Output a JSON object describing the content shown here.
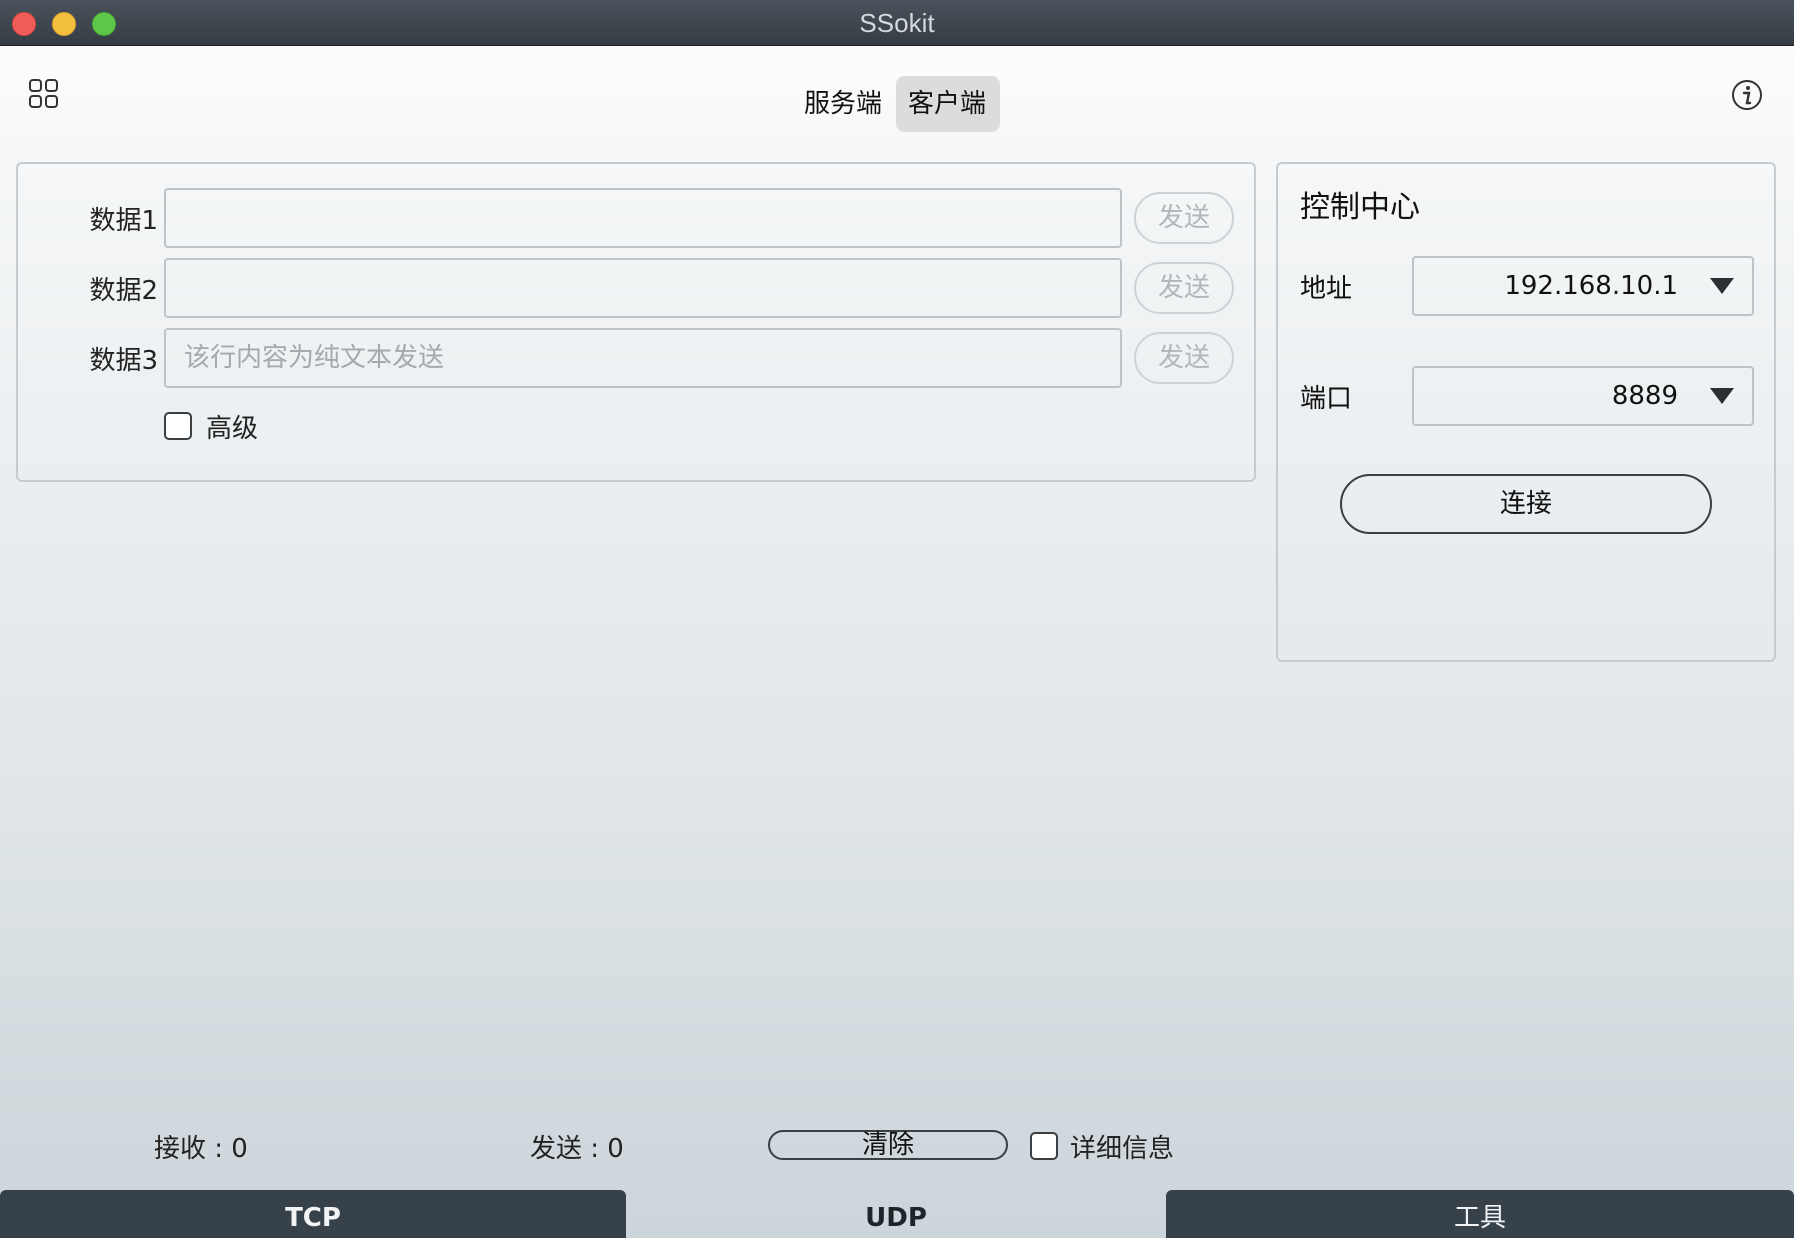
{
  "window": {
    "title": "SSokit"
  },
  "toolbar": {
    "grid_icon": "grid-icon",
    "info_icon": "info-icon",
    "tabs": [
      {
        "label": "服务端",
        "selected": false
      },
      {
        "label": "客户端",
        "selected": true
      }
    ]
  },
  "data_panel": {
    "rows": [
      {
        "label": "数据1",
        "value": "",
        "placeholder": "",
        "send_label": "发送"
      },
      {
        "label": "数据2",
        "value": "",
        "placeholder": "",
        "send_label": "发送"
      },
      {
        "label": "数据3",
        "value": "",
        "placeholder": "该行内容为纯文本发送",
        "send_label": "发送"
      }
    ],
    "advanced": {
      "label": "高级",
      "checked": false
    }
  },
  "control_center": {
    "title": "控制中心",
    "address": {
      "label": "地址",
      "value": "192.168.10.1"
    },
    "port": {
      "label": "端口",
      "value": "8889"
    },
    "connect_label": "连接"
  },
  "status_bar": {
    "received": "接收 : 0",
    "sent": "发送 : 0",
    "clear_label": "清除",
    "details": {
      "label": "详细信息",
      "checked": false
    }
  },
  "bottom_tabs": [
    {
      "label": "TCP",
      "selected": false
    },
    {
      "label": "UDP",
      "selected": true
    },
    {
      "label": "工具",
      "selected": false
    }
  ],
  "colors": {
    "titlebar": "#3f464e",
    "tab_dark": "#37414a",
    "close": "#ee5e56",
    "minimize": "#f4be3f",
    "maximize": "#5ec649"
  }
}
